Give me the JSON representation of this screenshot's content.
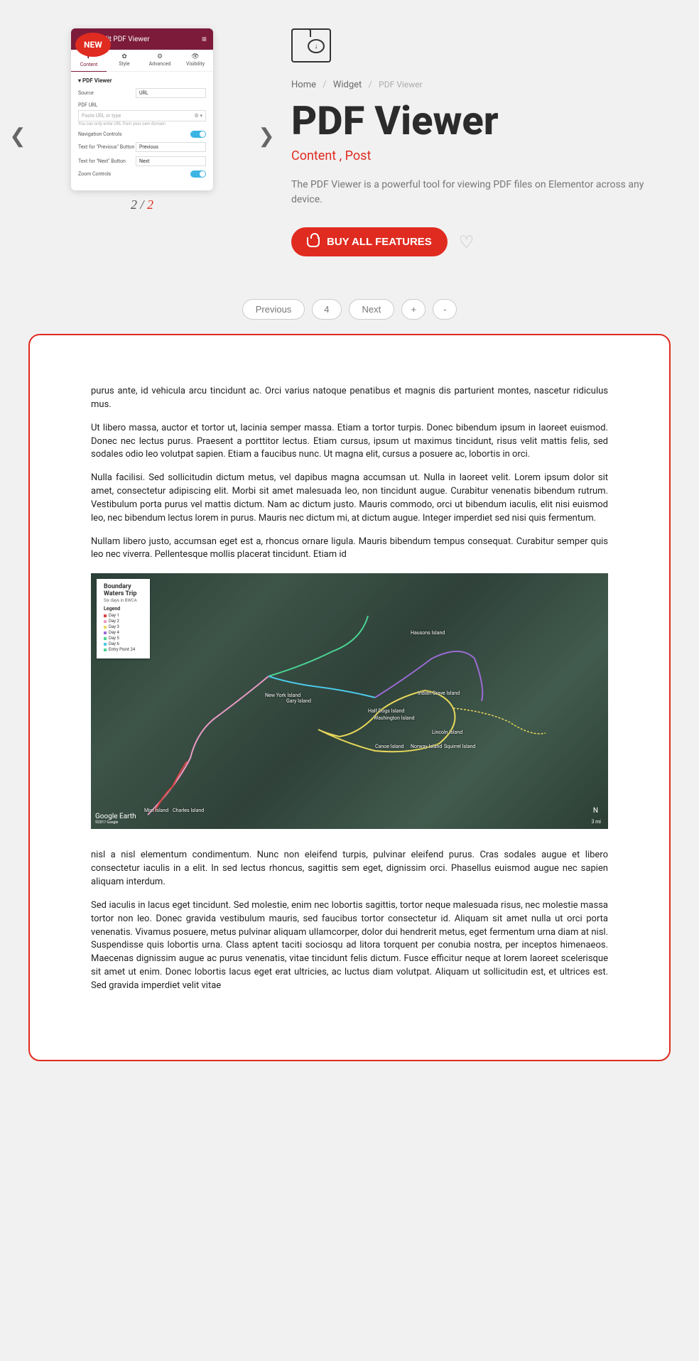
{
  "slide": {
    "badge": "NEW",
    "headerTitle": "Edit PDF Viewer",
    "tabs": [
      "Content",
      "Style",
      "Advanced",
      "Visibility"
    ],
    "activeTab": 0,
    "sectionTitle": "PDF Viewer",
    "rows": {
      "source": {
        "label": "Source",
        "value": "URL"
      },
      "pdfUrlLabel": "PDF URL",
      "pdfUrlPlaceholder": "Paste URL or type",
      "note": "You can only enter URL from your own domain",
      "navControls": "Navigation Controls",
      "prevBtn": {
        "label": "Text for \"Previous\" Button",
        "value": "Previous"
      },
      "nextBtn": {
        "label": "Text for \"Next\" Button",
        "value": "Next"
      },
      "zoomControls": "Zoom Controls"
    },
    "counter": {
      "current": "2",
      "total": "2"
    }
  },
  "breadcrumb": {
    "items": [
      "Home",
      "Widget"
    ],
    "current": "PDF Viewer"
  },
  "title": "PDF Viewer",
  "categories": "Content , Post",
  "description": "The PDF Viewer is a powerful tool for viewing PDF files on Elementor across any device.",
  "buyButton": "BUY ALL FEATURES",
  "pdfControls": {
    "prev": "Previous",
    "page": "4",
    "next": "Next",
    "zoomIn": "+",
    "zoomOut": "-"
  },
  "pdfBody": {
    "p1": "purus ante, id vehicula arcu tincidunt ac. Orci varius natoque penatibus et magnis dis parturient montes, nascetur ridiculus mus.",
    "p2": "Ut libero massa, auctor et tortor ut, lacinia semper massa. Etiam a tortor turpis. Donec bibendum ipsum in laoreet euismod. Donec nec lectus purus. Praesent a porttitor lectus. Etiam cursus, ipsum ut maximus tincidunt, risus velit mattis felis, sed sodales odio leo volutpat sapien. Etiam a faucibus nunc. Ut magna elit, cursus a posuere ac, lobortis in orci.",
    "p3": "Nulla facilisi. Sed sollicitudin dictum metus, vel dapibus magna accumsan ut. Nulla in laoreet velit. Lorem ipsum dolor sit amet, consectetur adipiscing elit. Morbi sit amet malesuada leo, non tincidunt augue. Curabitur venenatis bibendum rutrum. Vestibulum porta purus vel mattis dictum. Nam ac dictum justo. Mauris commodo, orci ut bibendum iaculis, elit nisi euismod leo, nec bibendum lectus lorem in purus. Mauris nec dictum mi, at dictum augue. Integer imperdiet sed nisi quis fermentum.",
    "p4": "Nullam libero justo, accumsan eget est a, rhoncus ornare ligula. Mauris bibendum tempus consequat. Curabitur semper quis leo nec viverra. Pellentesque mollis placerat tincidunt. Etiam id",
    "p5": "nisl a nisl elementum condimentum. Nunc non eleifend turpis, pulvinar eleifend purus. Cras sodales augue et libero consectetur iaculis in a elit. In sed lectus rhoncus, sagittis sem eget, dignissim orci. Phasellus euismod augue nec sapien aliquam interdum.",
    "p6": "Sed iaculis in lacus eget tincidunt. Sed molestie, enim nec lobortis sagittis, tortor neque malesuada risus, nec molestie massa tortor non leo. Donec gravida vestibulum mauris, sed faucibus tortor consectetur id. Aliquam sit amet nulla ut orci porta venenatis. Vivamus posuere, metus pulvinar aliquam ullamcorper, dolor dui hendrerit metus, eget fermentum urna diam at nisl. Suspendisse quis lobortis urna. Class aptent taciti sociosqu ad litora torquent per conubia nostra, per inceptos himenaeos. Maecenas dignissim augue ac purus venenatis, vitae tincidunt felis dictum. Fusce efficitur neque at lorem laoreet scelerisque sit amet ut enim. Donec lobortis lacus eget erat ultricies, ac luctus diam volutpat. Aliquam ut sollicitudin est, et ultrices est. Sed gravida imperdiet velit vitae"
  },
  "map": {
    "title": "Boundary Waters Trip",
    "subtitle": "Six days in BWCA",
    "legendHeader": "Legend",
    "legendItems": [
      {
        "label": "Day 1",
        "color": "#d94545"
      },
      {
        "label": "Day 2",
        "color": "#e89bc5"
      },
      {
        "label": "Day 3",
        "color": "#e8d85a"
      },
      {
        "label": "Day 4",
        "color": "#9b6bd4"
      },
      {
        "label": "Day 5",
        "color": "#4bd493"
      },
      {
        "label": "Day 6",
        "color": "#4bc9e8"
      },
      {
        "label": "Entry Point 24",
        "color": "#4bd493"
      }
    ],
    "labels": {
      "hausons": "Hausons Island",
      "newYork": "New York Island",
      "gary": "Gary Island",
      "indian": "Indian Grave Island",
      "halfDogs": "Half Dogs Island",
      "washington": "Washington Island",
      "lincoln": "Lincoln Island",
      "canoe": "Canoe Island",
      "norway": "Norway Island",
      "squirrel": "Squirrel Island",
      "mist": "Mist Island",
      "charles": "Charles Island"
    },
    "attribution": "Google Earth",
    "attributionSmall": "©2017 Google",
    "scale": "3 mi",
    "compass": "N"
  }
}
